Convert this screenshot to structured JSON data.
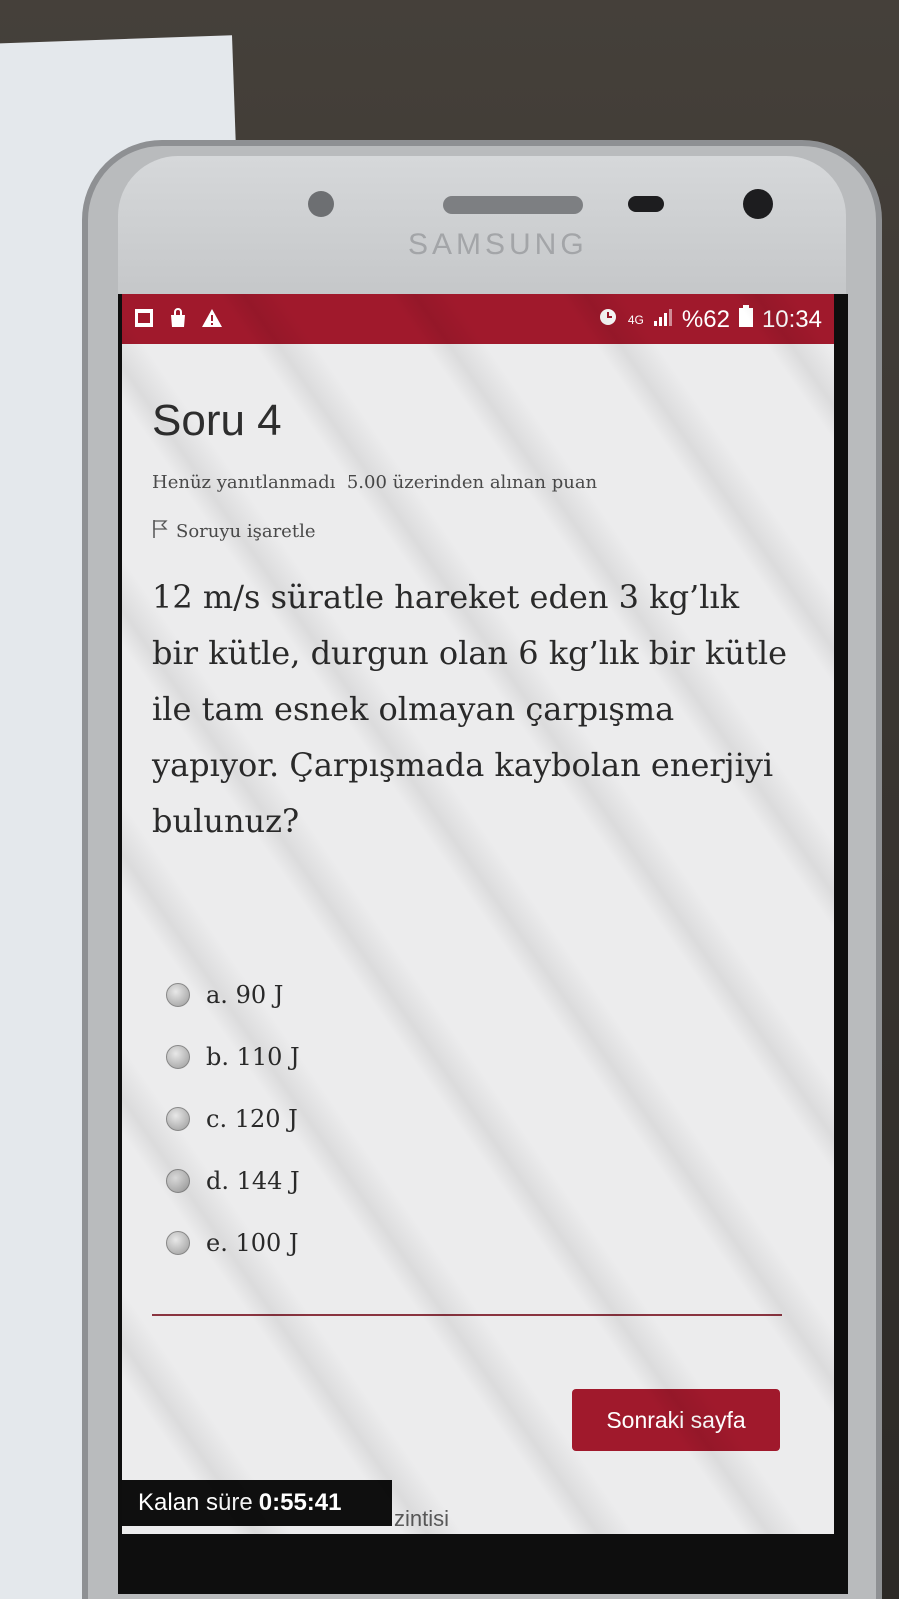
{
  "statusbar": {
    "network": "4G",
    "battery": "%62",
    "time": "10:34"
  },
  "device": {
    "brand": "SAMSUNG"
  },
  "question": {
    "title": "Soru 4",
    "status": "Henüz yanıtlanmadı",
    "score": "5.00 üzerinden alınan puan",
    "flag_label": "Soruyu işaretle",
    "text": "12 m/s süratle hareket eden 3 kg’lık bir kütle, durgun olan 6 kg’lık bir kütle ile tam esnek olmayan çarpışma yapıyor. Çarpışmada kaybolan enerjiyi bulunuz?",
    "options": [
      {
        "label": "a. 90 J"
      },
      {
        "label": "b. 110 J"
      },
      {
        "label": "c. 120 J"
      },
      {
        "label": "d. 144 J"
      },
      {
        "label": "e. 100 J"
      }
    ]
  },
  "navigation": {
    "next_label": "Sonraki sayfa"
  },
  "timer": {
    "label": "Kalan süre",
    "value": "0:55:41"
  },
  "footer": {
    "partial_text": "zintisi"
  },
  "colors": {
    "accent": "#a0192c",
    "screen_bg": "#ececed"
  },
  "icons": {
    "statusbar_left": [
      "gallery-icon",
      "bag-icon",
      "warning-icon"
    ],
    "statusbar_right": [
      "alarm-icon",
      "signal-icon",
      "battery-icon"
    ],
    "flag": "flag-icon"
  }
}
